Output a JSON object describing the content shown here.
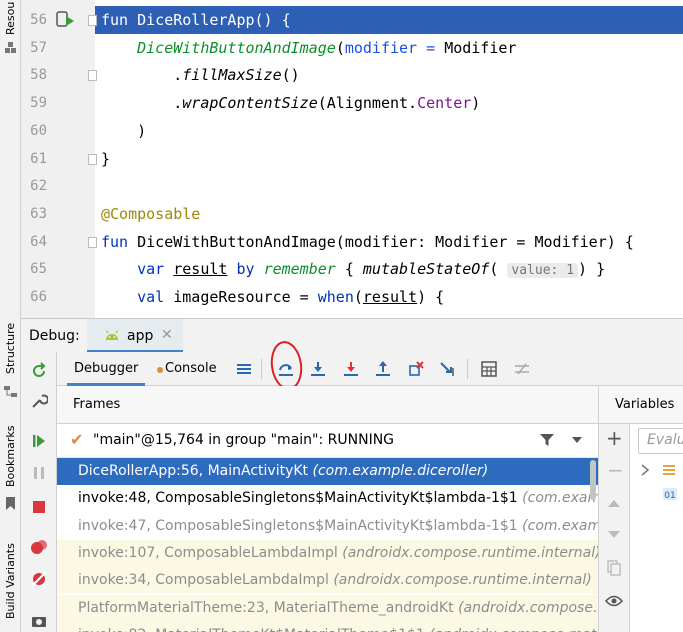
{
  "left_strip": {
    "labels": [
      "Resou",
      "Structure",
      "Bookmarks",
      "Build Variants"
    ]
  },
  "editor": {
    "lines": [
      {
        "num": "56",
        "tokens": [
          [
            "kw",
            "fun "
          ],
          [
            "",
            "DiceRollerApp() {"
          ]
        ],
        "highlight": true
      },
      {
        "num": "57",
        "tokens": [
          [
            "comp",
            "    DiceWithButtonAndImage"
          ],
          [
            "",
            "("
          ],
          [
            "param",
            "modifier"
          ],
          [
            "param",
            " = "
          ],
          [
            "",
            "Modifier"
          ]
        ]
      },
      {
        "num": "58",
        "tokens": [
          [
            "",
            "        ."
          ],
          [
            "ital",
            "fillMaxSize"
          ],
          [
            "",
            "()"
          ]
        ]
      },
      {
        "num": "59",
        "tokens": [
          [
            "",
            "        ."
          ],
          [
            "ital",
            "wrapContentSize"
          ],
          [
            "",
            "(Alignment."
          ],
          [
            "prop",
            "Center"
          ],
          [
            "",
            ")"
          ]
        ]
      },
      {
        "num": "60",
        "tokens": [
          [
            "",
            "    )"
          ]
        ]
      },
      {
        "num": "61",
        "tokens": [
          [
            "",
            "}"
          ]
        ]
      },
      {
        "num": "62",
        "tokens": []
      },
      {
        "num": "63",
        "tokens": [
          [
            "ann",
            "@Composable"
          ]
        ]
      },
      {
        "num": "64",
        "tokens": [
          [
            "kw",
            "fun "
          ],
          [
            "",
            "DiceWithButtonAndImage(modifier: Modifier = Modifier) {"
          ]
        ]
      },
      {
        "num": "65",
        "tokens": [
          [
            "kw",
            "    var "
          ],
          [
            "und",
            "result"
          ],
          [
            "kw",
            " by "
          ],
          [
            "comp",
            "remember"
          ],
          [
            "",
            " { "
          ],
          [
            "ital",
            "mutableStateOf"
          ],
          [
            "",
            "( "
          ],
          [
            "hint",
            "value: 1"
          ],
          [
            "",
            ") }"
          ]
        ]
      },
      {
        "num": "66",
        "tokens": [
          [
            "kw",
            "    val "
          ],
          [
            "",
            "imageResource = "
          ],
          [
            "kw",
            "when"
          ],
          [
            "",
            "("
          ],
          [
            "und",
            "result"
          ],
          [
            "",
            ") {"
          ]
        ]
      }
    ]
  },
  "debug": {
    "label": "Debug:",
    "tab_label": "app",
    "debugger_tab": "Debugger",
    "console_tab": "Console",
    "frames_title": "Frames",
    "variables_title": "Variables",
    "thread": "\"main\"@15,764 in group \"main\": RUNNING",
    "eval_placeholder": "Evalu",
    "frames": [
      {
        "method": "DiceRollerApp:56, MainActivityKt",
        "pkg": "(com.example.diceroller)",
        "style": "sel"
      },
      {
        "method": "invoke:48, ComposableSingletons$MainActivityKt$lambda-1$1",
        "pkg": "(com.example",
        "style": "normal"
      },
      {
        "method": "invoke:47, ComposableSingletons$MainActivityKt$lambda-1$1",
        "pkg": "(com.example",
        "style": "gray"
      },
      {
        "method": "invoke:107, ComposableLambdaImpl",
        "pkg": "(androidx.compose.runtime.internal)",
        "style": "lib"
      },
      {
        "method": "invoke:34, ComposableLambdaImpl",
        "pkg": "(androidx.compose.runtime.internal)",
        "style": "lib"
      },
      {
        "method": "PlatformMaterialTheme:23, MaterialTheme_androidKt",
        "pkg": "(androidx.compose.ma",
        "style": "lib"
      },
      {
        "method": "invoke:82, MaterialThemeKt$MaterialTheme$1$1",
        "pkg": "(androidx.compose.materia",
        "style": "lib"
      }
    ]
  },
  "colors": {
    "accent": "#2d6bbf",
    "annotation": "#e21d1d"
  }
}
